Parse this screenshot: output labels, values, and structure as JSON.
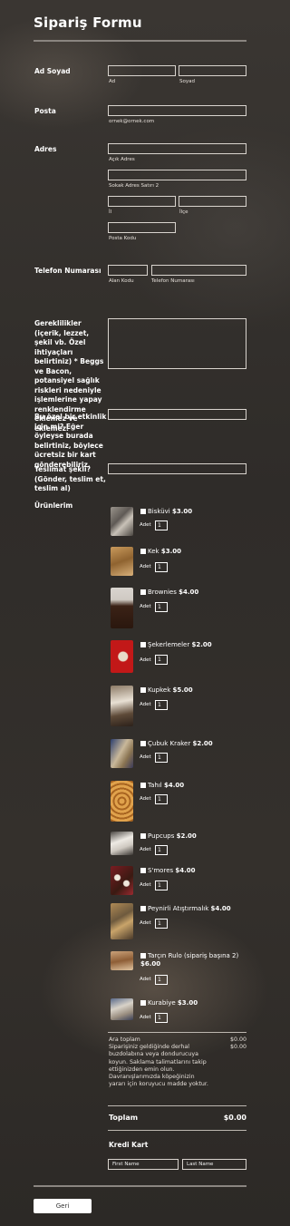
{
  "form": {
    "title": "Sipariş Formu",
    "name_label": "Ad Soyad",
    "first_sub": "Ad",
    "last_sub": "Soyad",
    "email_label": "Posta",
    "email_sub": "ornek@ornek.com",
    "address_label": "Adres",
    "street1_sub": "Açık Adres",
    "street2_sub": "Sokak Adres Satırı 2",
    "city_sub": "İl",
    "district_sub": "İlçe",
    "postal_sub": "Posta Kodu",
    "phone_label": "Telefon Numarası",
    "area_sub": "Alan Kodu",
    "phone_sub": "Telefon Numarası",
    "requirements_label": "Gereklilikler (içerik, lezzet, şekil vb. Özel ihtiyaçları belirtiniz) * Beggs ve Bacon, potansiyel sağlık riskleri nedeniyle işlemlerine yapay renklendirme eklemez ve eklemez.",
    "event_label": "Bu özel bir etkinlik için mi? Eğer öyleyse burada belirtiniz, böylece ücretsiz bir kart gönderebiliriz.",
    "delivery_label": "Teslimat şekli? (Gönder, teslim et, teslim al)",
    "products_label": "Ürünlerim",
    "qty_label": "Adet",
    "products": [
      {
        "name": "Bisküvi",
        "price": "$3.00",
        "qty": "1",
        "img": "biscuit-image"
      },
      {
        "name": "Kek",
        "price": "$3.00",
        "qty": "1",
        "img": "cake-image"
      },
      {
        "name": "Brownies",
        "price": "$4.00",
        "qty": "1",
        "img": "brownies-image"
      },
      {
        "name": "Şekerlemeler",
        "price": "$2.00",
        "qty": "1",
        "img": "candies-image"
      },
      {
        "name": "Kupkek",
        "price": "$5.00",
        "qty": "1",
        "img": "cupcake-image"
      },
      {
        "name": "Çubuk Kraker",
        "price": "$2.00",
        "qty": "1",
        "img": "stick-cracker-image"
      },
      {
        "name": "Tahıl",
        "price": "$4.00",
        "qty": "1",
        "img": "grain-image"
      },
      {
        "name": "Pupcups",
        "price": "$2.00",
        "qty": "1",
        "img": "pupcups-image"
      },
      {
        "name": "S'mores",
        "price": "$4.00",
        "qty": "1",
        "img": "smores-image"
      },
      {
        "name": "Peynirli Atıştırmalık",
        "price": "$4.00",
        "qty": "1",
        "img": "cheese-snack-image"
      },
      {
        "name": "Tarçın Rulo (sipariş başına 2)",
        "price": "$6.00",
        "qty": "1",
        "img": "cinnamon-roll-image"
      },
      {
        "name": "Kurabiye",
        "price": "$3.00",
        "qty": "1",
        "img": "cookie-image"
      }
    ],
    "subtotal_label": "Ara toplam",
    "subtotal_value": "$0.00",
    "note": "Siparişiniz geldiğinde derhal buzdolabına veya dondurucuya koyun. Saklama talimatlarını takip ettiğinizden emin olun. Davranışlarımızda köpeğinizin yararı için koruyucu madde yoktur.",
    "note_value": "$0.00",
    "total_label": "Toplam",
    "total_value": "$0.00",
    "card_title": "Kredi Kart",
    "first_name_ph": "First Name",
    "last_name_ph": "Last Name",
    "back_button": "Geri"
  }
}
